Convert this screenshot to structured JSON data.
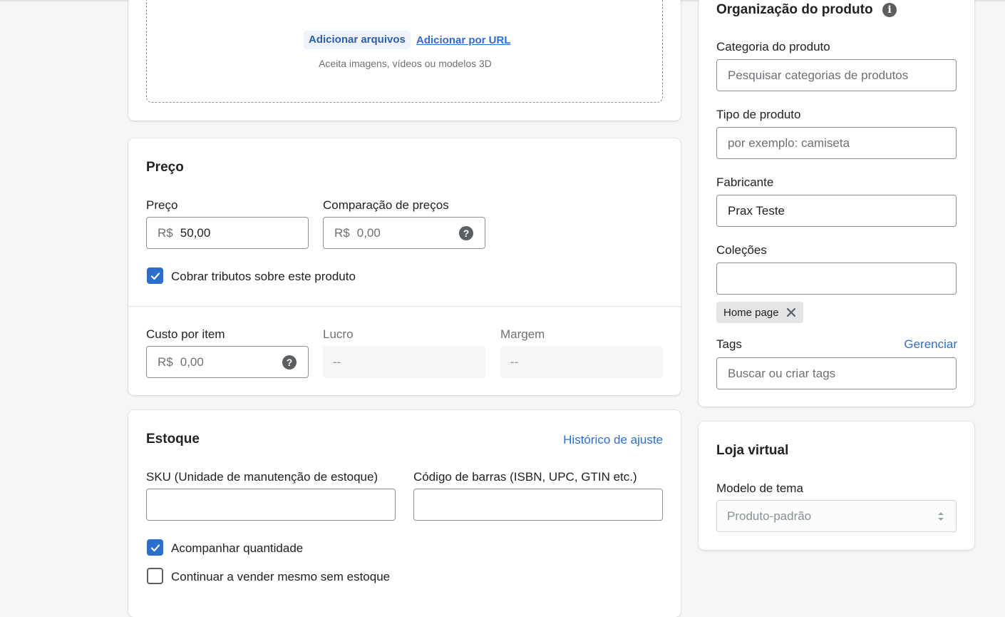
{
  "media": {
    "add_files": "Adicionar arquivos",
    "add_url": "Adicionar por URL",
    "hint": "Aceita imagens, vídeos ou modelos 3D"
  },
  "pricing": {
    "title": "Preço",
    "price_label": "Preço",
    "currency": "R$",
    "price_value": "50,00",
    "compare_label": "Comparação de preços",
    "compare_placeholder": "0,00",
    "charge_tax_label": "Cobrar tributos sobre este produto",
    "charge_tax_checked": true,
    "cost_label": "Custo por item",
    "cost_placeholder": "0,00",
    "profit_label": "Lucro",
    "profit_value": "--",
    "margin_label": "Margem",
    "margin_value": "--"
  },
  "inventory": {
    "title": "Estoque",
    "history_link": "Histórico de ajuste",
    "sku_label": "SKU (Unidade de manutenção de estoque)",
    "sku_value": "",
    "barcode_label": "Código de barras (ISBN, UPC, GTIN etc.)",
    "barcode_value": "",
    "track_quantity_label": "Acompanhar quantidade",
    "track_quantity_checked": true,
    "continue_selling_label": "Continuar a vender mesmo sem estoque",
    "continue_selling_checked": false
  },
  "organization": {
    "title": "Organização do produto",
    "category_label": "Categoria do produto",
    "category_placeholder": "Pesquisar categorias de produtos",
    "type_label": "Tipo de produto",
    "type_placeholder": "por exemplo: camiseta",
    "vendor_label": "Fabricante",
    "vendor_value": "Prax Teste",
    "collections_label": "Coleções",
    "collections_value": "",
    "collection_tags": [
      "Home page"
    ],
    "tags_label": "Tags",
    "tags_manage_link": "Gerenciar",
    "tags_placeholder": "Buscar ou criar tags"
  },
  "online_store": {
    "title": "Loja virtual",
    "theme_template_label": "Modelo de tema",
    "theme_template_value": "Produto-padrão"
  },
  "colors": {
    "accent": "#2c6ecb",
    "page_bg": "#f6f6f7",
    "card_bg": "#ffffff",
    "text": "#202223",
    "subdued": "#6d7175"
  }
}
